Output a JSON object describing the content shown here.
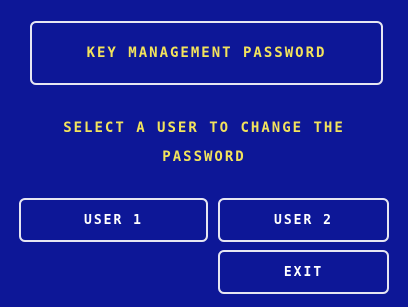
{
  "screen": {
    "title": "KEY MANAGEMENT PASSWORD",
    "prompt_line1": "SELECT A USER TO CHANGE THE",
    "prompt_line2": "PASSWORD"
  },
  "buttons": {
    "user1": "USER 1",
    "user2": "USER 2",
    "exit": "EXIT"
  },
  "colors": {
    "background": "#0d1797",
    "text_highlight": "#f2e35c",
    "button_text": "#ffffff",
    "border": "#e6e6f2"
  }
}
